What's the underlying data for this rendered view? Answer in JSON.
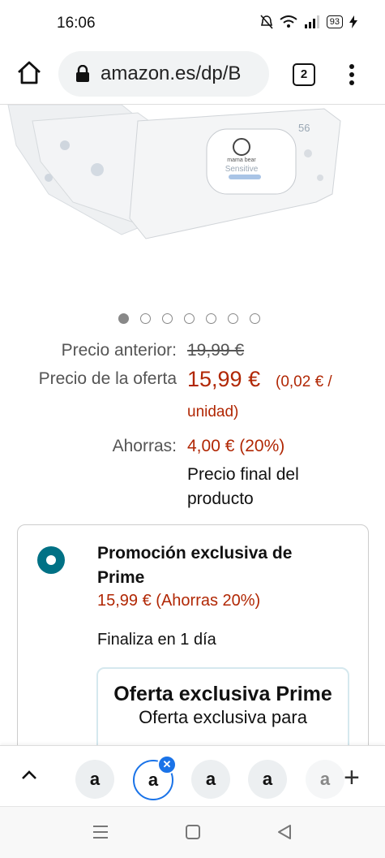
{
  "status_bar": {
    "time": "16:06",
    "battery": "93"
  },
  "browser": {
    "url": "amazon.es/dp/B",
    "tab_count": "2"
  },
  "carousel": {
    "count": 7,
    "active_index": 0,
    "image_badge": "56",
    "brand_text": "mama bear",
    "product_text": "Sensitive"
  },
  "pricing": {
    "prev_label": "Precio anterior:",
    "prev_value": "19,99 €",
    "offer_label": "Precio de la oferta",
    "offer_value": "15,99 €",
    "unit_price_line1": "(0,02 € /",
    "unit_price_line2": "unidad)",
    "savings_label": "Ahorras:",
    "savings_value": "4,00 € (20%)",
    "final_line1": "Precio final del",
    "final_line2": "producto"
  },
  "promo": {
    "title": "Promoción exclusiva de Prime",
    "price": "15,99 € (Ahorras 20%)",
    "ends": "Finaliza en 1 día",
    "box_title": "Oferta exclusiva Prime",
    "box_subtitle": "Oferta exclusiva para"
  },
  "tab_strip": {
    "tab_letter": "a"
  },
  "colors": {
    "price_red": "#b12704",
    "radio_teal": "#007185",
    "tab_selected": "#1a73e8"
  }
}
